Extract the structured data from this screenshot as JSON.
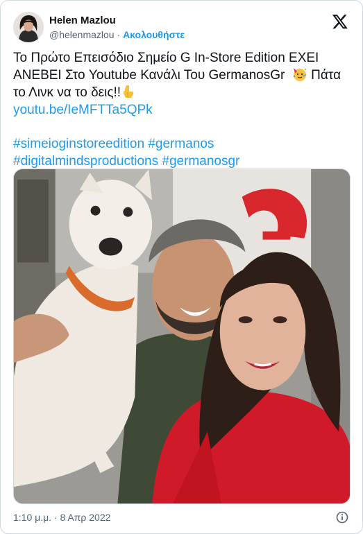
{
  "author": {
    "display_name": "Helen Mazlou",
    "handle": "@helenmazlou",
    "separator": " · ",
    "follow_label": "Ακολουθήστε"
  },
  "tweet": {
    "line1": "Το Πρώτο Επεισόδιο Σημείο G In-Store Edition ΕΧΕΙ",
    "line2": "ΑΝΕΒΕΙ Στο Youtube Κανάλι Του GermanosGr",
    "line3_after_emoji": " Πάτα",
    "line4": "το Λινκ να το δεις!!",
    "link": "youtu.be/IeMFTTa5QPk",
    "hashtags_line1": "#simeioginstoreedition #germanos",
    "hashtags_line2": "#digitalmindsproductions #germanosgr"
  },
  "footer": {
    "timestamp": "1:10 μ.μ. · 8 Απρ 2022"
  },
  "icons": {
    "brand": "x-logo",
    "info": "info-icon",
    "emoji_party": "partying-face-emoji",
    "emoji_point": "backhand-index-pointing-down-emoji"
  },
  "colors": {
    "link": "#1d9bf0",
    "text": "#0f1419",
    "muted": "#536471",
    "border": "#cfd9de"
  }
}
